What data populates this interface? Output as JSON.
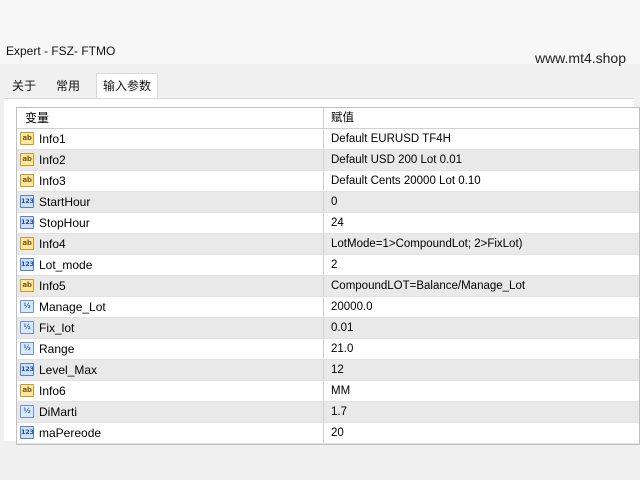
{
  "window": {
    "title": "Expert - FSZ- FTMO",
    "watermark": "www.mt4.shop"
  },
  "tabs": [
    {
      "label": "关于",
      "active": false
    },
    {
      "label": "常用",
      "active": false
    },
    {
      "label": "输入参数",
      "active": true
    }
  ],
  "table": {
    "headers": {
      "variable": "变量",
      "value": "赋值"
    },
    "rows": [
      {
        "icon": "ab",
        "icon_text": "ab",
        "name": "Info1",
        "value": "Default EURUSD TF4H",
        "selected": false
      },
      {
        "icon": "ab",
        "icon_text": "ab",
        "name": "Info2",
        "value": "Default USD 200 Lot 0.01",
        "selected": true
      },
      {
        "icon": "ab",
        "icon_text": "ab",
        "name": "Info3",
        "value": "Default Cents 20000 Lot 0.10",
        "selected": false
      },
      {
        "icon": "num",
        "icon_text": "123",
        "name": "StartHour",
        "value": "0",
        "selected": true
      },
      {
        "icon": "num",
        "icon_text": "123",
        "name": "StopHour",
        "value": "24",
        "selected": false
      },
      {
        "icon": "ab",
        "icon_text": "ab",
        "name": "Info4",
        "value": "LotMode=1>CompoundLot; 2>FixLot)",
        "selected": true
      },
      {
        "icon": "num",
        "icon_text": "123",
        "name": "Lot_mode",
        "value": "2",
        "selected": false
      },
      {
        "icon": "ab",
        "icon_text": "ab",
        "name": "Info5",
        "value": "CompoundLOT=Balance/Manage_Lot",
        "selected": true
      },
      {
        "icon": "dbl",
        "icon_text": "½",
        "name": "Manage_Lot",
        "value": "20000.0",
        "selected": false
      },
      {
        "icon": "dbl",
        "icon_text": "½",
        "name": "Fix_lot",
        "value": "0.01",
        "selected": true
      },
      {
        "icon": "dbl",
        "icon_text": "½",
        "name": "Range",
        "value": "21.0",
        "selected": false
      },
      {
        "icon": "num",
        "icon_text": "123",
        "name": "Level_Max",
        "value": "12",
        "selected": true
      },
      {
        "icon": "ab",
        "icon_text": "ab",
        "name": "Info6",
        "value": "MM",
        "selected": false
      },
      {
        "icon": "dbl",
        "icon_text": "½",
        "name": "DiMarti",
        "value": "1.7",
        "selected": true
      },
      {
        "icon": "num",
        "icon_text": "123",
        "name": "maPereode",
        "value": "20",
        "selected": false
      }
    ]
  }
}
